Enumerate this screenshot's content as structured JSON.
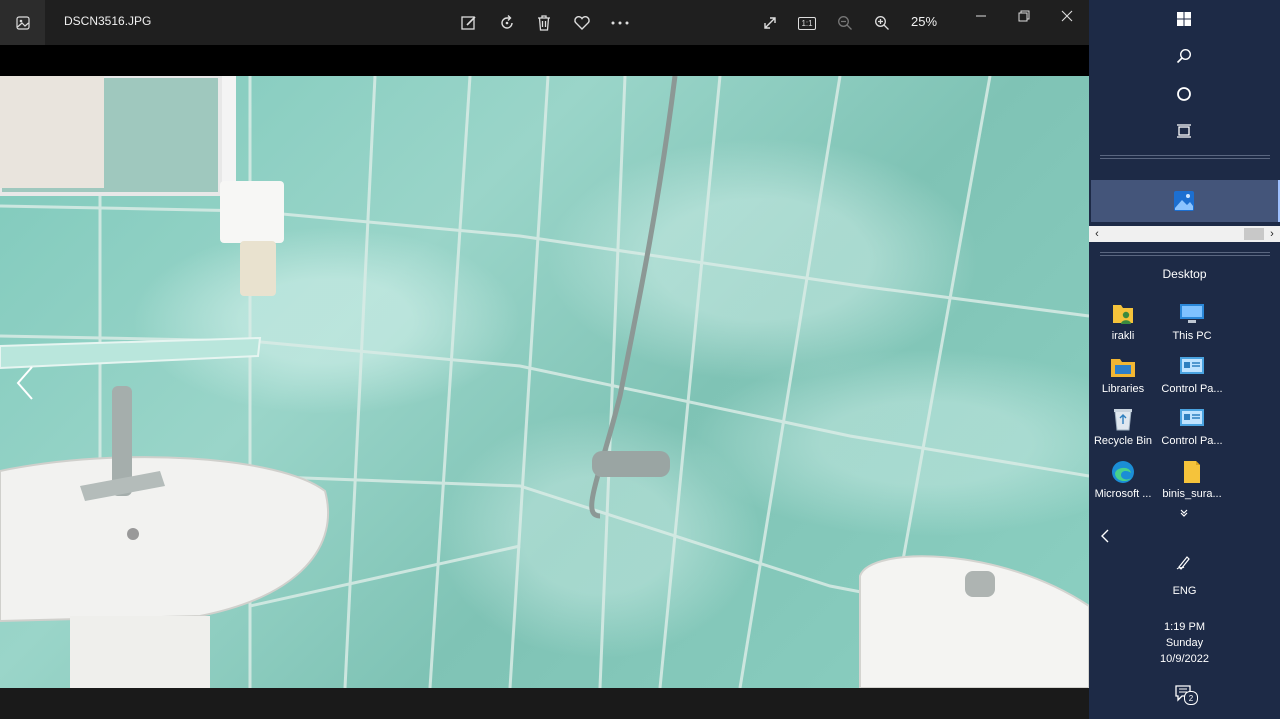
{
  "window": {
    "filename": "DSCN3516.JPG",
    "zoom": "25%",
    "toolbar": [
      "edit-icon",
      "rotate-icon",
      "delete-icon",
      "favorite-icon",
      "more-icon"
    ],
    "view_tools": [
      "expand-icon",
      "actual-size-icon",
      "zoom-out-icon",
      "zoom-in-icon"
    ],
    "actual_size_label": "1:1"
  },
  "panel": {
    "desktop_title": "Desktop",
    "desktop_icons": [
      {
        "label": "irakli",
        "icon": "user-folder-icon"
      },
      {
        "label": "This PC",
        "icon": "computer-icon"
      },
      {
        "label": "Libraries",
        "icon": "libraries-icon"
      },
      {
        "label": "Control Pa...",
        "icon": "control-panel-icon"
      },
      {
        "label": "Recycle Bin",
        "icon": "recycle-bin-icon"
      },
      {
        "label": "Control Pa...",
        "icon": "control-panel-icon"
      },
      {
        "label": "Microsoft ...",
        "icon": "edge-icon"
      },
      {
        "label": "binis_sura...",
        "icon": "folder-icon"
      }
    ],
    "language": "ENG",
    "time": "1:19 PM",
    "day": "Sunday",
    "date": "10/9/2022",
    "notification_count": "2"
  }
}
